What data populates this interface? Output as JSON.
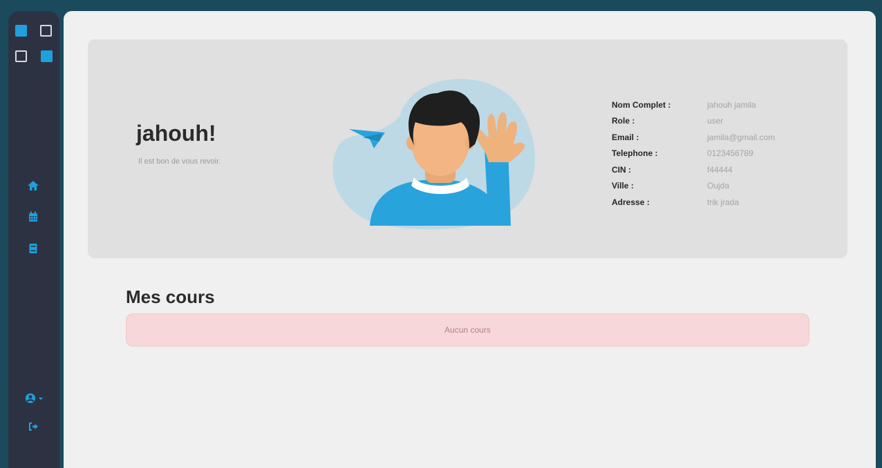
{
  "sidebar": {
    "nav": [
      {
        "icon": "home-icon"
      },
      {
        "icon": "calendar-icon"
      },
      {
        "icon": "book-icon"
      }
    ],
    "user_menu_icon": "user-circle-icon",
    "logout_icon": "sign-out-icon",
    "accent_color": "#1fa0dc"
  },
  "hero": {
    "greeting": "jahouh!",
    "subtitle": "Il est bon de vous revoir."
  },
  "profile": {
    "fields": [
      {
        "label": "Nom Complet :",
        "value": "jahouh jamila"
      },
      {
        "label": "Role :",
        "value": "user"
      },
      {
        "label": "Email :",
        "value": "jamila@gmail.com"
      },
      {
        "label": "Telephone :",
        "value": "0123456789"
      },
      {
        "label": "CIN :",
        "value": "f44444"
      },
      {
        "label": "Ville :",
        "value": "Oujda"
      },
      {
        "label": "Adresse :",
        "value": "trik jrada"
      }
    ]
  },
  "courses": {
    "title": "Mes cours",
    "empty_message": "Aucun cours"
  }
}
